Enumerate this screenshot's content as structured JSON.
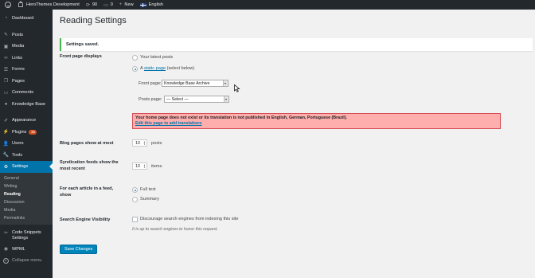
{
  "adminbar": {
    "site_name": "HeroThemes Development",
    "updates_count": "90",
    "comments_count": "0",
    "new_label": "New",
    "language": "English"
  },
  "sidebar": {
    "items": [
      {
        "label": "Dashboard",
        "icon": "dashboard-icon"
      },
      {
        "label": "Posts",
        "icon": "pin-icon"
      },
      {
        "label": "Media",
        "icon": "media-icon"
      },
      {
        "label": "Links",
        "icon": "link-icon"
      },
      {
        "label": "Forms",
        "icon": "forms-icon"
      },
      {
        "label": "Pages",
        "icon": "pages-icon"
      },
      {
        "label": "Comments",
        "icon": "comments-icon"
      },
      {
        "label": "Knowledge Base",
        "icon": "knowledge-base-icon"
      },
      {
        "label": "Appearance",
        "icon": "appearance-icon"
      },
      {
        "label": "Plugins",
        "icon": "plugins-icon",
        "badge": "15"
      },
      {
        "label": "Users",
        "icon": "users-icon"
      },
      {
        "label": "Tools",
        "icon": "tools-icon"
      },
      {
        "label": "Settings",
        "icon": "settings-icon"
      }
    ],
    "settings_sub": [
      "General",
      "Writing",
      "Reading",
      "Discussion",
      "Media",
      "Permalinks"
    ],
    "code_snippets": "Code Snippets",
    "code_snippets_line2": "Settings",
    "wpml": "WPML",
    "collapse": "Collapse menu"
  },
  "page": {
    "title": "Reading Settings",
    "notice": "Settings saved.",
    "front_page_displays": "Front page displays",
    "opt_latest_posts": "Your latest posts",
    "opt_static_prefix": "A ",
    "opt_static_link": "static page",
    "opt_static_suffix": " (select below)",
    "front_page_label": "Front page:",
    "front_page_value": "Knowledge Base Archive",
    "posts_page_label": "Posts page:",
    "posts_page_value": "— Select —",
    "error_line1": "Your home page does not exist or its translation is not published in English, German, Portuguese (Brazil).",
    "error_link": "Edit this page to add translations",
    "blog_pages_label": "Blog pages show at most",
    "blog_pages_value": "10",
    "blog_pages_unit": "posts",
    "synd_label_line1": "Syndication feeds show the",
    "synd_label_line2": "most recent",
    "synd_value": "10",
    "synd_unit": "items",
    "article_label_line1": "For each article in a feed,",
    "article_label_line2": "show",
    "opt_full_text": "Full text",
    "opt_summary": "Summary",
    "sev_label": "Search Engine Visibility",
    "sev_checkbox": "Discourage search engines from indexing this site",
    "sev_desc": "It is up to search engines to honor this request.",
    "save_button": "Save Changes"
  },
  "colors": {
    "admin_bg": "#23282d",
    "accent": "#0073aa",
    "button": "#0085ba",
    "notice_border": "#46b450",
    "error_bg": "#ffaeae",
    "error_border": "#d54e55"
  }
}
